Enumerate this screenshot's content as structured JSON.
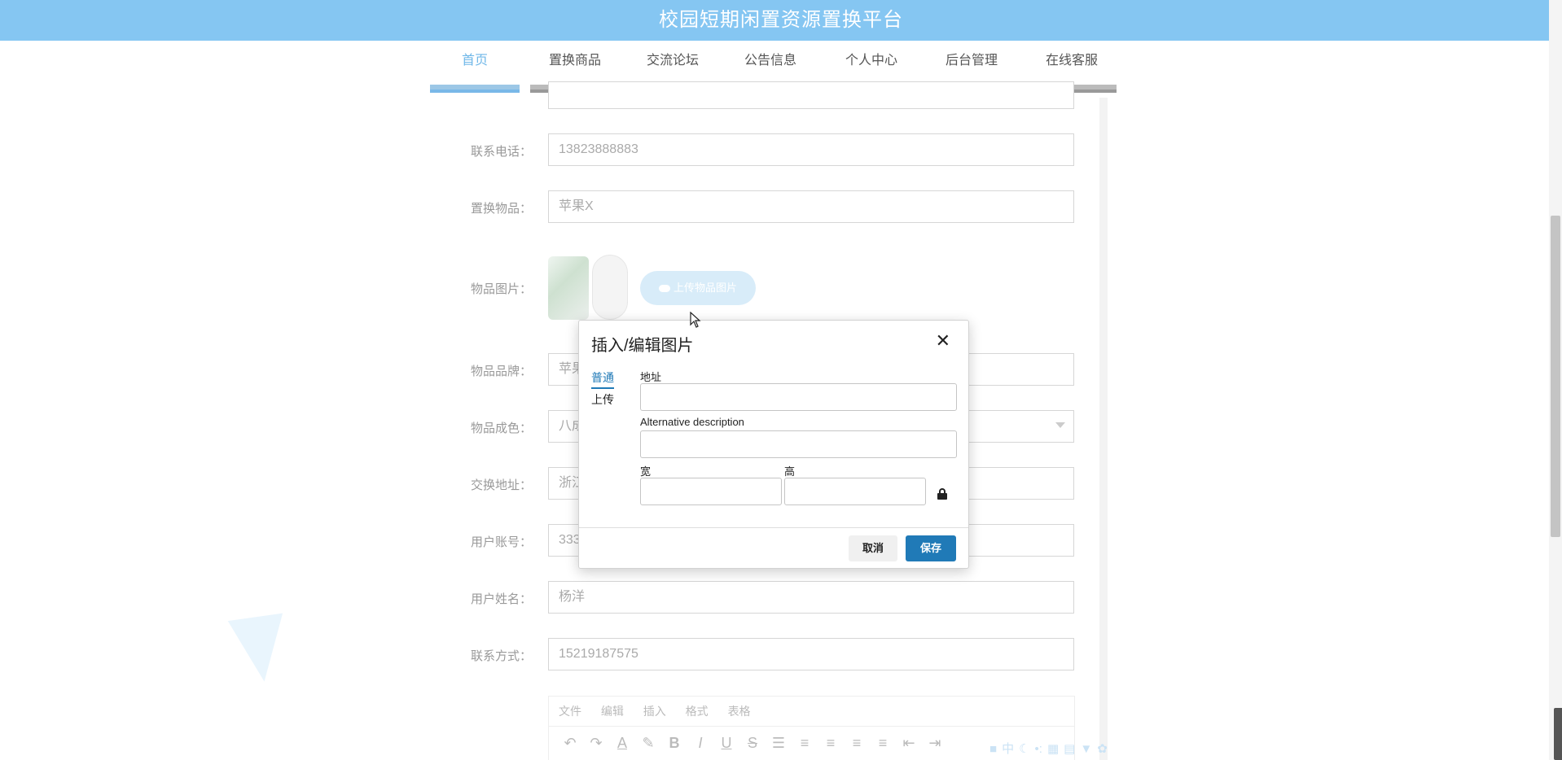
{
  "header": {
    "title": "校园短期闲置资源置换平台"
  },
  "nav": {
    "items": [
      {
        "label": "首页",
        "active": true
      },
      {
        "label": "置换商品"
      },
      {
        "label": "交流论坛"
      },
      {
        "label": "公告信息"
      },
      {
        "label": "个人中心"
      },
      {
        "label": "后台管理"
      },
      {
        "label": "在线客服"
      }
    ]
  },
  "form": {
    "phone": {
      "label": "联系电话：",
      "value": "13823888883"
    },
    "item": {
      "label": "置换物品：",
      "value": "苹果X"
    },
    "image": {
      "label": "物品图片：",
      "upload_label": "上传物品图片"
    },
    "brand": {
      "label": "物品品牌：",
      "value": "苹果"
    },
    "condition": {
      "label": "物品成色：",
      "value": "八成新"
    },
    "address": {
      "label": "交换地址：",
      "value": "浙江"
    },
    "account": {
      "label": "用户账号：",
      "value": "333"
    },
    "username": {
      "label": "用户姓名：",
      "value": "杨洋"
    },
    "contact": {
      "label": "联系方式：",
      "value": "15219187575"
    }
  },
  "editor": {
    "menu": [
      "文件",
      "编辑",
      "插入",
      "格式",
      "表格"
    ]
  },
  "modal": {
    "title": "插入/编辑图片",
    "tabs": {
      "general": "普通",
      "upload": "上传"
    },
    "fields": {
      "url_label": "地址",
      "alt_label": "Alternative description",
      "width_label": "宽",
      "height_label": "高"
    },
    "buttons": {
      "cancel": "取消",
      "save": "保存"
    }
  },
  "colors": {
    "header_bg": "#85c6f2",
    "primary": "#207ab7",
    "nav_active": "#6fb7e8"
  }
}
